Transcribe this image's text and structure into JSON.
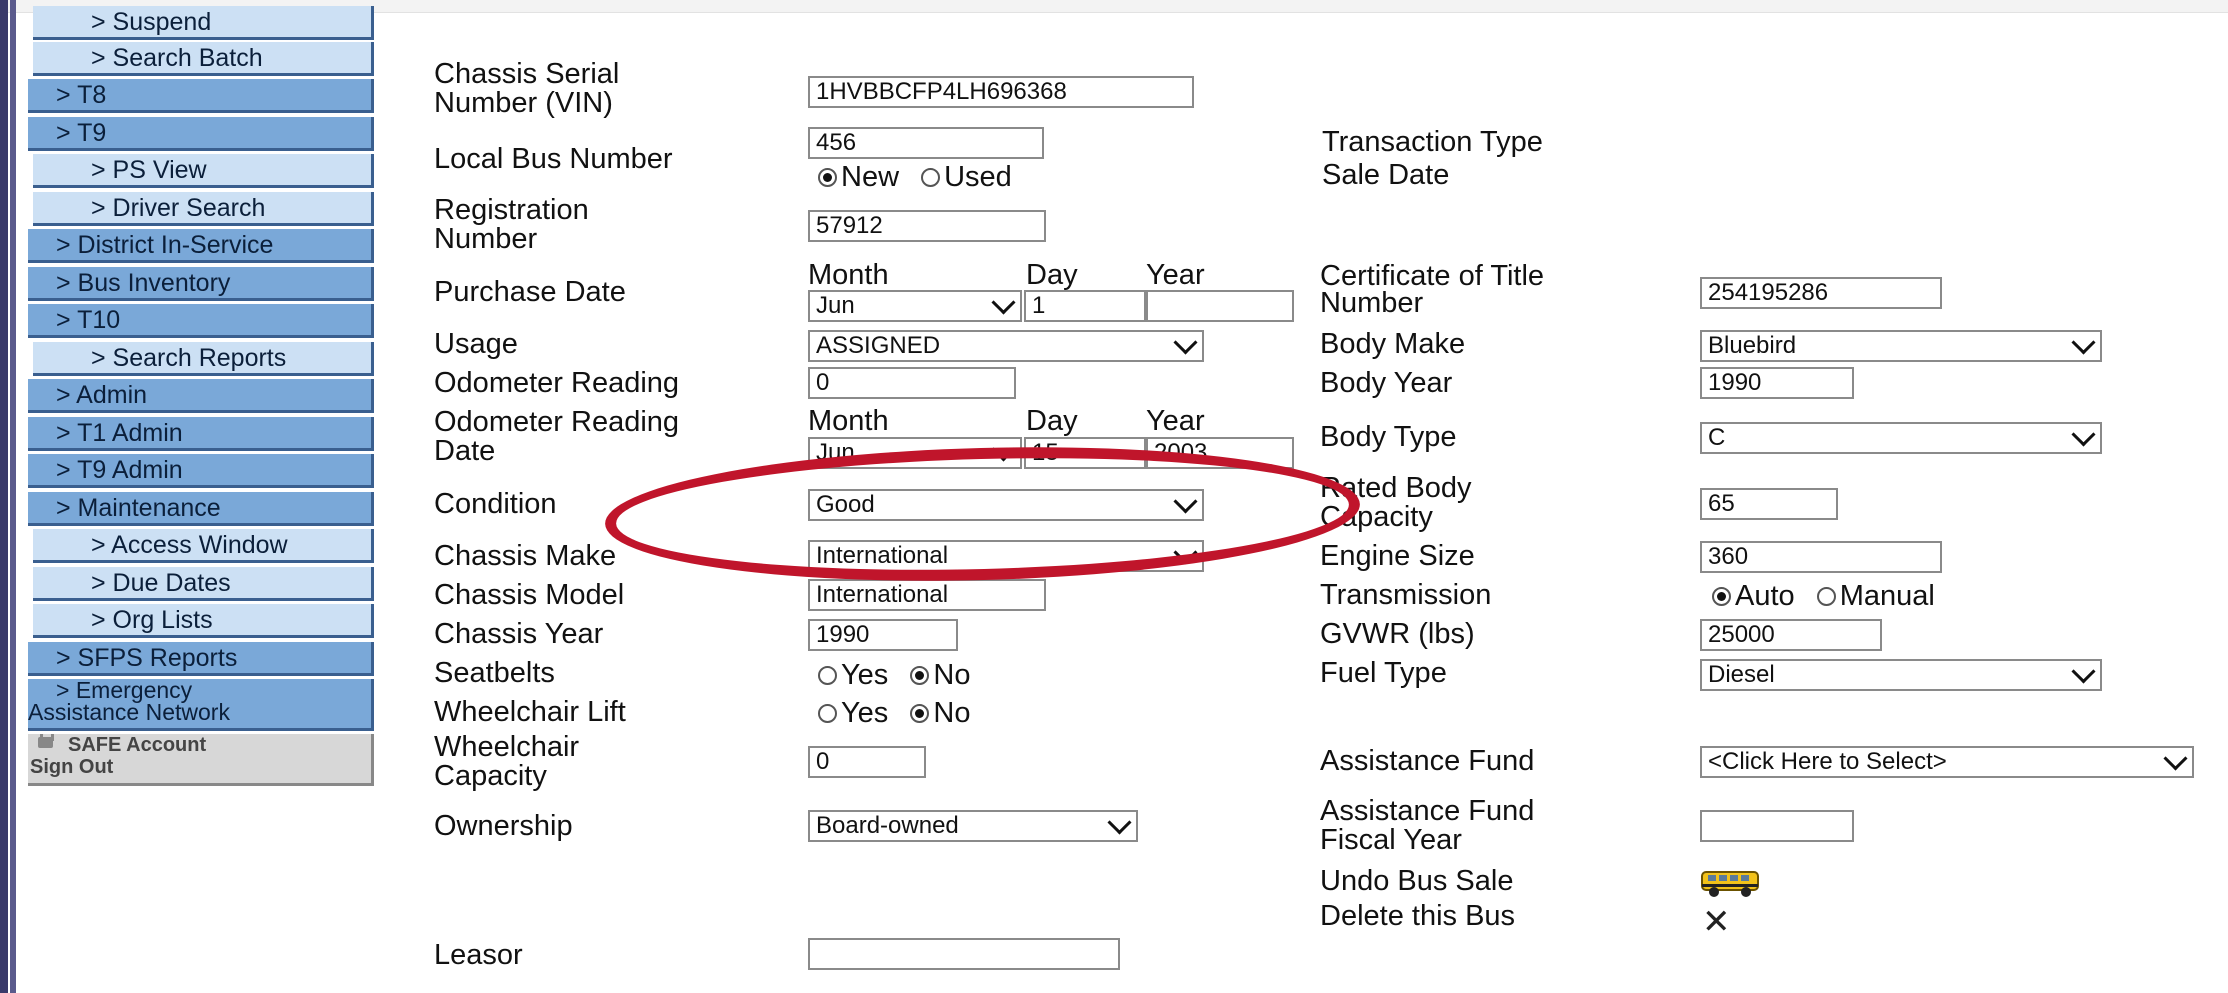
{
  "nav": {
    "items": [
      {
        "label": "> Suspend",
        "level": 2
      },
      {
        "label": "> Search Batch",
        "level": 2
      },
      {
        "label": "> T8",
        "level": 1
      },
      {
        "label": "> T9",
        "level": 1
      },
      {
        "label": "> PS View",
        "level": 2
      },
      {
        "label": "> Driver Search",
        "level": 2
      },
      {
        "label": "> District In-Service",
        "level": 1
      },
      {
        "label": "> Bus Inventory",
        "level": 1
      },
      {
        "label": "> T10",
        "level": 1
      },
      {
        "label": "> Search Reports",
        "level": 2
      },
      {
        "label": "> Admin",
        "level": 1
      },
      {
        "label": "> T1 Admin",
        "level": 1
      },
      {
        "label": "> T9 Admin",
        "level": 1
      },
      {
        "label": "> Maintenance",
        "level": 1
      },
      {
        "label": "> Access Window",
        "level": 2
      },
      {
        "label": "> Due Dates",
        "level": 2
      },
      {
        "label": "> Org Lists",
        "level": 2
      },
      {
        "label": "> SFPS Reports",
        "level": 1
      }
    ],
    "emergency_line1": "> Emergency",
    "emergency_line2": "Assistance Network",
    "safe_account": "SAFE Account",
    "sign_out": "Sign Out",
    "lock_icon": "lock-icon"
  },
  "form": {
    "vin_label_1": "Chassis Serial",
    "vin_label_2": "Number (VIN)",
    "vin_value": "1HVBBCFP4LH696368",
    "local_bus_label": "Local Bus Number",
    "local_bus_value": "456",
    "new_label": "New",
    "used_label": "Used",
    "new_used_selected": "New",
    "transaction_type_label": "Transaction Type",
    "sale_date_label": "Sale Date",
    "registration_label_1": "Registration",
    "registration_label_2": "Number",
    "registration_value": "57912",
    "purchase_date_label": "Purchase Date",
    "month_label": "Month",
    "day_label": "Day",
    "year_label": "Year",
    "purchase_month": "Jun",
    "purchase_day": "1",
    "purchase_year": "",
    "cert_title_label_1": "Certificate of Title",
    "cert_title_label_2": "Number",
    "cert_title_value": "254195286",
    "usage_label": "Usage",
    "usage_value": "ASSIGNED",
    "body_make_label": "Body Make",
    "body_make_value": "Bluebird",
    "odometer_label": "Odometer Reading",
    "odometer_value": "0",
    "body_year_label": "Body Year",
    "body_year_value": "1990",
    "odometer_date_label_1": "Odometer Reading",
    "odometer_date_label_2": "Date",
    "odometer_month": "Jun",
    "odometer_day": "15",
    "odometer_year": "2003",
    "body_type_label": "Body Type",
    "body_type_value": "C",
    "condition_label": "Condition",
    "condition_value": "Good",
    "rated_capacity_label_1": "Rated Body",
    "rated_capacity_label_2": "Capacity",
    "rated_capacity_value": "65",
    "chassis_make_label": "Chassis Make",
    "chassis_make_value": "International",
    "engine_size_label": "Engine Size",
    "engine_size_value": "360",
    "chassis_model_label": "Chassis Model",
    "chassis_model_value": "International",
    "transmission_label": "Transmission",
    "auto_label": "Auto",
    "manual_label": "Manual",
    "transmission_selected": "Auto",
    "chassis_year_label": "Chassis Year",
    "chassis_year_value": "1990",
    "gvwr_label": "GVWR (lbs)",
    "gvwr_value": "25000",
    "seatbelts_label": "Seatbelts",
    "yes_label": "Yes",
    "no_label": "No",
    "seatbelts_selected": "No",
    "fuel_type_label": "Fuel Type",
    "fuel_type_value": "Diesel",
    "wheelchair_lift_label": "Wheelchair Lift",
    "wheelchair_lift_selected": "No",
    "wheelchair_capacity_label_1": "Wheelchair",
    "wheelchair_capacity_label_2": "Capacity",
    "wheelchair_capacity_value": "0",
    "assistance_fund_label": "Assistance Fund",
    "assistance_fund_value": "<Click Here to Select>",
    "ownership_label": "Ownership",
    "ownership_value": "Board-owned",
    "assistance_fy_label_1": "Assistance Fund",
    "assistance_fy_label_2": "Fiscal Year",
    "assistance_fy_value": "",
    "undo_sale_label": "Undo Bus Sale",
    "delete_bus_label": "Delete this Bus",
    "leasor_label": "Leasor",
    "leasor_value": ""
  },
  "annotation": {
    "color": "#c0152b",
    "shape": "ellipse"
  }
}
